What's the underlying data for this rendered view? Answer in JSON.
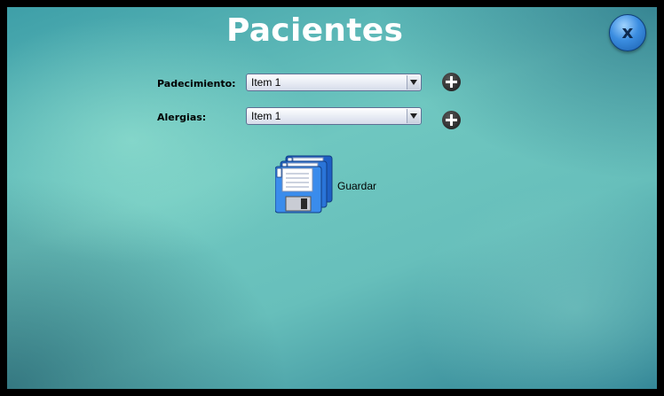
{
  "window": {
    "title": "Pacientes"
  },
  "close_button": {
    "label": "x"
  },
  "form": {
    "padecimiento": {
      "label": "Padecimiento:",
      "selected": "Item 1"
    },
    "alergias": {
      "label": "Alergias:",
      "selected": "Item 1"
    }
  },
  "save_button": {
    "label": "Guardar",
    "icon": "floppy-disks-icon"
  },
  "colors": {
    "background_light": "#6fc7c0",
    "background_dark": "#2c7f92",
    "close_button": "#3b8de0",
    "add_button": "#333333",
    "title": "#ffffff"
  }
}
